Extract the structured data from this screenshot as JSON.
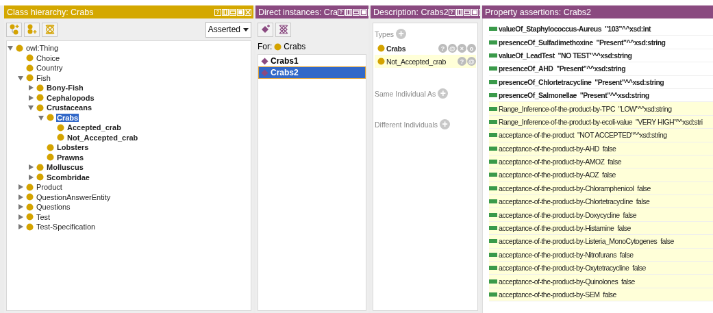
{
  "class_hierarchy": {
    "title": "Class hierarchy: Crabs",
    "help_button": "?",
    "mode": "Asserted",
    "tree": [
      {
        "label": "owl:Thing",
        "bold": false,
        "selected": false,
        "expanded": true,
        "children": [
          {
            "label": "Choice",
            "bold": false,
            "selected": false
          },
          {
            "label": "Country",
            "bold": false,
            "selected": false
          },
          {
            "label": "Fish",
            "bold": false,
            "selected": false,
            "expanded": true,
            "children": [
              {
                "label": "Bony-Fish",
                "bold": true,
                "selected": false,
                "expanded": false
              },
              {
                "label": "Cephalopods",
                "bold": true,
                "selected": false,
                "expanded": false
              },
              {
                "label": "Crustaceans",
                "bold": true,
                "selected": false,
                "expanded": true,
                "children": [
                  {
                    "label": "Crabs",
                    "bold": true,
                    "selected": true,
                    "expanded": true,
                    "children": [
                      {
                        "label": "Accepted_crab",
                        "bold": true,
                        "selected": false
                      },
                      {
                        "label": "Not_Accepted_crab",
                        "bold": true,
                        "selected": false
                      }
                    ]
                  },
                  {
                    "label": "Lobsters",
                    "bold": true,
                    "selected": false
                  },
                  {
                    "label": "Prawns",
                    "bold": true,
                    "selected": false
                  }
                ]
              },
              {
                "label": "Molluscus",
                "bold": true,
                "selected": false,
                "expanded": false
              },
              {
                "label": "Scombridae",
                "bold": true,
                "selected": false,
                "expanded": false
              }
            ]
          },
          {
            "label": "Product",
            "bold": false,
            "selected": false,
            "expanded": false
          },
          {
            "label": "QuestionAnswerEntity",
            "bold": false,
            "selected": false,
            "expanded": false
          },
          {
            "label": "Questions",
            "bold": false,
            "selected": false,
            "expanded": false
          },
          {
            "label": "Test",
            "bold": false,
            "selected": false,
            "expanded": false
          },
          {
            "label": "Test-Specification",
            "bold": false,
            "selected": false,
            "expanded": false
          }
        ]
      }
    ]
  },
  "direct_instances": {
    "title": "Direct instances: Cra",
    "for_label": "For:",
    "for_class": "Crabs",
    "items": [
      {
        "label": "Crabs1",
        "selected": false
      },
      {
        "label": "Crabs2",
        "selected": true
      }
    ]
  },
  "description": {
    "title": "Description: Crabs2",
    "sections": [
      {
        "label": "Types",
        "add_button": "+",
        "entries": [
          {
            "label": "Crabs",
            "inferred": false,
            "buttons": [
              "?",
              "@",
              "×",
              "o"
            ]
          },
          {
            "label": "Not_Accepted_crab",
            "inferred": true,
            "buttons": [
              "?",
              "@"
            ]
          }
        ]
      },
      {
        "label": "Same Individual As",
        "add_button": "+"
      },
      {
        "label": "Different Individuals",
        "add_button": "+"
      }
    ]
  },
  "property_assertions": {
    "title": "Property assertions: Crabs2",
    "rows": [
      {
        "text": "valueOf_Staphylococcus-Aureus  \"103\"^^xsd:int",
        "inferred": false
      },
      {
        "text": "presenceOf_Sulfadimethoxine  \"Present\"^^xsd:string",
        "inferred": false
      },
      {
        "text": "valueOf_LeadTest  \"NO TEST\"^^xsd:string",
        "inferred": false
      },
      {
        "text": "presenceOf_AHD  \"Present\"^^xsd:string",
        "inferred": false
      },
      {
        "text": "presenceOf_Chlortetracycline  \"Present\"^^xsd:string",
        "inferred": false
      },
      {
        "text": "presenceOf_Salmonellae  \"Present\"^^xsd:string",
        "inferred": false
      },
      {
        "text": "Range_Inference-of-the-product-by-TPC  \"LOW\"^^xsd:string",
        "inferred": true
      },
      {
        "text": "Range_Inference-of-the-product-by-ecoli-value  \"VERY HIGH\"^^xsd:stri",
        "inferred": true
      },
      {
        "text": "acceptance-of-the-product  \"NOT ACCEPTED\"^^xsd:string",
        "inferred": true
      },
      {
        "text": "acceptance-of-the-product-by-AHD  false",
        "inferred": true
      },
      {
        "text": "acceptance-of-the-product-by-AMOZ  false",
        "inferred": true
      },
      {
        "text": "acceptance-of-the-product-by-AOZ  false",
        "inferred": true
      },
      {
        "text": "acceptance-of-the-product-by-Chloramphenicol  false",
        "inferred": true
      },
      {
        "text": "acceptance-of-the-product-by-Chlortetracycline  false",
        "inferred": true
      },
      {
        "text": "acceptance-of-the-product-by-Doxycycline  false",
        "inferred": true
      },
      {
        "text": "acceptance-of-the-product-by-Histamine  false",
        "inferred": true
      },
      {
        "text": "acceptance-of-the-product-by-Listeria_MonoCytogenes  false",
        "inferred": true
      },
      {
        "text": "acceptance-of-the-product-by-Nitrofurans  false",
        "inferred": true
      },
      {
        "text": "acceptance-of-the-product-by-Oxytetracycline  false",
        "inferred": true
      },
      {
        "text": "acceptance-of-the-product-by-Quinolones  false",
        "inferred": true
      },
      {
        "text": "acceptance-of-the-product-by-SEM  false",
        "inferred": true
      }
    ]
  }
}
